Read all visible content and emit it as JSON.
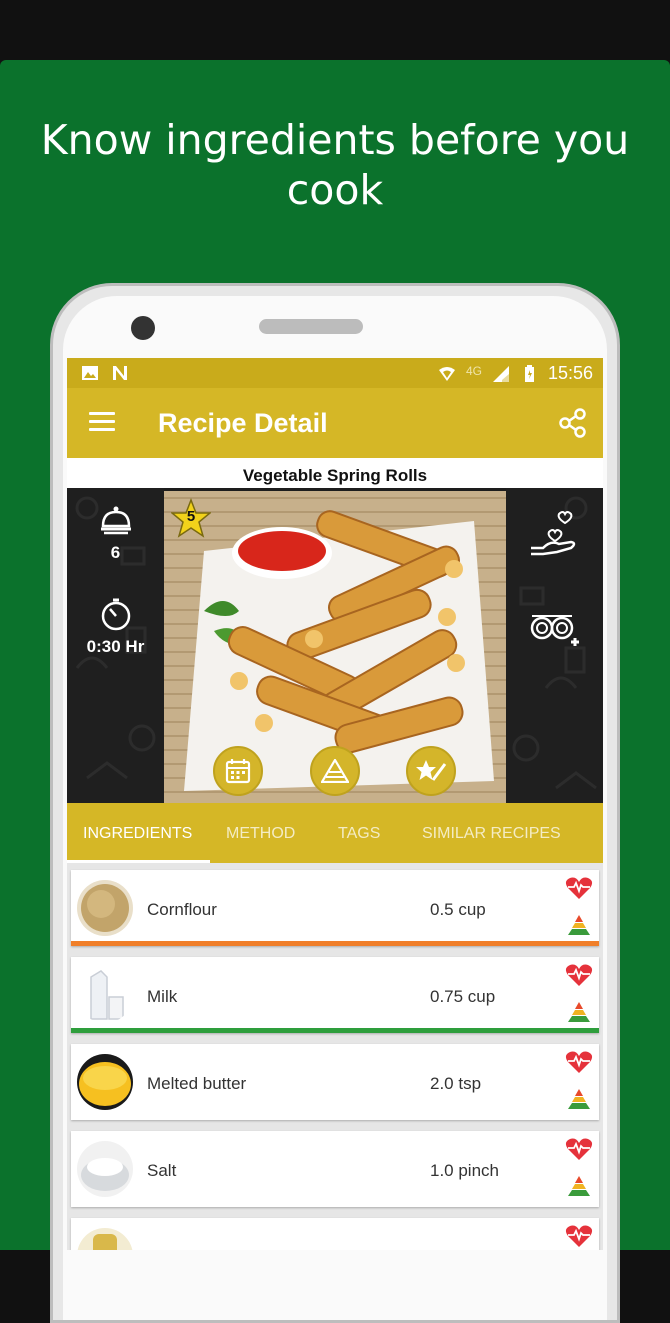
{
  "headline": "Know ingredients before you cook",
  "status_bar": {
    "network": "4G",
    "time": "15:56"
  },
  "app_bar": {
    "title": "Recipe Detail"
  },
  "recipe": {
    "title": "Vegetable Spring Rolls",
    "servings": "6",
    "time": "0:30 Hr",
    "rating": "5"
  },
  "tabs": [
    {
      "label": "INGREDIENTS",
      "active": true
    },
    {
      "label": "METHOD",
      "active": false
    },
    {
      "label": "TAGS",
      "active": false
    },
    {
      "label": "SIMILAR RECIPES",
      "active": false
    }
  ],
  "ingredients": [
    {
      "name": "Cornflour",
      "qty": "0.5 cup",
      "bar_color": "#f07f2a"
    },
    {
      "name": "Milk",
      "qty": "0.75 cup",
      "bar_color": "#2e9e3c"
    },
    {
      "name": "Melted butter",
      "qty": "2.0 tsp",
      "bar_color": ""
    },
    {
      "name": "Salt",
      "qty": "1.0 pinch",
      "bar_color": ""
    },
    {
      "name": "",
      "qty": "",
      "bar_color": ""
    }
  ],
  "colors": {
    "background_green": "#0b722c",
    "app_bar_gold": "#d5b726",
    "status_bar_gold": "#c9ab1b",
    "heart_red": "#e5323b"
  },
  "icons": {
    "menu": "menu-icon",
    "share": "share-icon",
    "servings": "serving-cloche-icon",
    "time": "timer-icon",
    "calendar": "calendar-icon",
    "nutrition": "pyramid-icon",
    "rate": "star-edit-icon",
    "donate": "hand-heart-icon",
    "add_cookware": "cookware-add-icon",
    "health": "heart-pulse-icon"
  }
}
